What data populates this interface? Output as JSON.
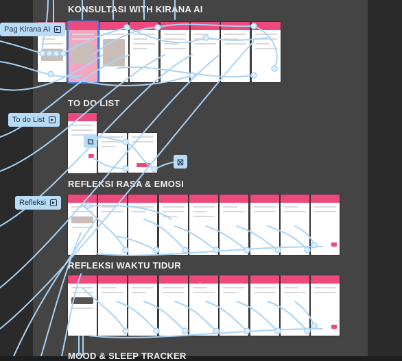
{
  "sections": [
    {
      "title": "KONSULTASI WITH KIRANA AI"
    },
    {
      "title": "TO DO LIST"
    },
    {
      "title": "REFLEKSI RASA & EMOSI"
    },
    {
      "title": "REFLEKSI WAKTU TIDUR"
    },
    {
      "title": "MOOD & SLEEP TRACKER"
    }
  ],
  "flow_labels": {
    "kirana": "Pag Kirana AI",
    "todo": "To do List",
    "refleksi": "Refleksi"
  },
  "icons": {
    "flow_start": "play-frame-icon",
    "component": "component-icon",
    "close": "close-icon"
  },
  "colors": {
    "canvas": "#1e1e1e",
    "section": "#444444",
    "header_pink": "#ec4a7d",
    "wire": "#a9d3f5",
    "label_bg": "#b8dcf8"
  }
}
